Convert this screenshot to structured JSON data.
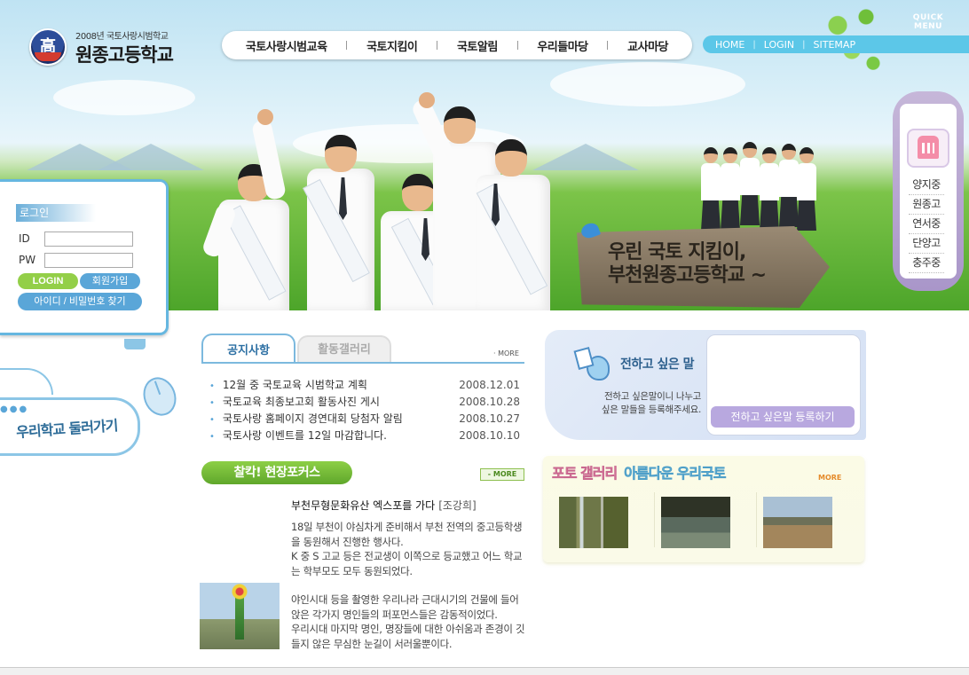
{
  "header": {
    "logo_emblem": "高",
    "logo_sub": "2008년 국토사랑시범학교",
    "logo_name": "원종고등학교",
    "gnb": [
      "국토사랑시범교육",
      "국토지킴이",
      "국토알림",
      "우리들마당",
      "교사마당"
    ],
    "util": [
      "HOME",
      "LOGIN",
      "SITEMAP"
    ],
    "sign_line1": "우린 국토 지킴이,",
    "sign_line2": "부천원종고등학교 ~"
  },
  "quick_menu": {
    "title_line1": "QUICK",
    "title_line2": "MENU",
    "items": [
      "양지중",
      "원종고",
      "연서중",
      "단양고",
      "충주중"
    ]
  },
  "login": {
    "title": "로그인",
    "id_label": "ID",
    "pw_label": "PW",
    "id_value": "",
    "pw_value": "",
    "login_button": "LOGIN",
    "join_button": "회원가입",
    "find_button": "아이디 / 비밀번호 찾기"
  },
  "tour": {
    "label": "우리학교 둘러가기"
  },
  "notice": {
    "tab_active": "공지사항",
    "tab_inactive": "활동갤러리",
    "more": "· MORE",
    "items": [
      {
        "title": "12월 중 국토교육 시범학교 계획",
        "date": "2008.12.01"
      },
      {
        "title": "국토교육 최종보고회 활동사진 게시",
        "date": "2008.10.28"
      },
      {
        "title": "국토사랑 홈페이지 경연대회 당첨자 알림",
        "date": "2008.10.27"
      },
      {
        "title": "국토사랑 이벤트를 12일 마감합니다.",
        "date": "2008.10.10"
      }
    ]
  },
  "focus": {
    "title": "찰칵! 현장포커스",
    "more": "- MORE",
    "article_title": "부천무형문화유산 엑스포를 가다",
    "article_author": "[조강희]",
    "article_p1": "18일 부천이 야심차게 준비해서 부천 전역의 중고등학생을 동원해서 진행한 행사다.",
    "article_p2": "K 중 S 고교 등은 전교생이 이쪽으로 등교했고 어느 학교는 학부모도 모두 동원되었다.",
    "article_p3": "야인시대 등을 촬영한 우리나라 근대시기의 건물에 들어앉은 각가지 명인들의 퍼포먼스들은 감동적이었다.",
    "article_p4": "우리시대 마지막 명인, 명장들에 대한 아쉬움과 존경이 깃들지 않은 무심한 눈길이 서러울뿐이다."
  },
  "message": {
    "title": "전하고 싶은 말",
    "desc_line1": "전하고 싶은말이니 나누고",
    "desc_line2": "싶은 말들을 등록해주세요.",
    "button": "전하고 싶은말 등록하기"
  },
  "gallery": {
    "title_a": "포토 갤러리",
    "title_b": "아름다운 우리국토",
    "more": "MORE"
  }
}
